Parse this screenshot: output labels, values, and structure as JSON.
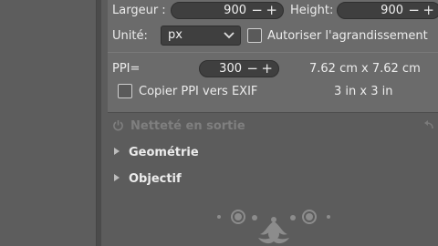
{
  "resize": {
    "width_label": "Largeur :",
    "width_value": "900",
    "height_label": "Height:",
    "height_value": "900",
    "unit_label": "Unité:",
    "unit_value": "px",
    "allow_upscale_label": "Autoriser l'agrandissement",
    "allow_upscale_checked": false,
    "ppi_label": "PPI=",
    "ppi_value": "300",
    "size_cm": "7.62 cm x 7.62 cm",
    "copy_ppi_label": "Copier PPI vers EXIF",
    "copy_ppi_checked": false,
    "size_in": "3 in x 3 in",
    "minus_symbol": "−",
    "plus_symbol": "+"
  },
  "tools": {
    "sharpening_label": "Netteté en sortie",
    "geometry_label": "Geométrie",
    "lens_label": "Objectif"
  },
  "icons": {
    "power": "power-icon",
    "reset": "reset-icon",
    "chevron": "chevron-down-icon",
    "ornament": "flourish-ornament"
  }
}
